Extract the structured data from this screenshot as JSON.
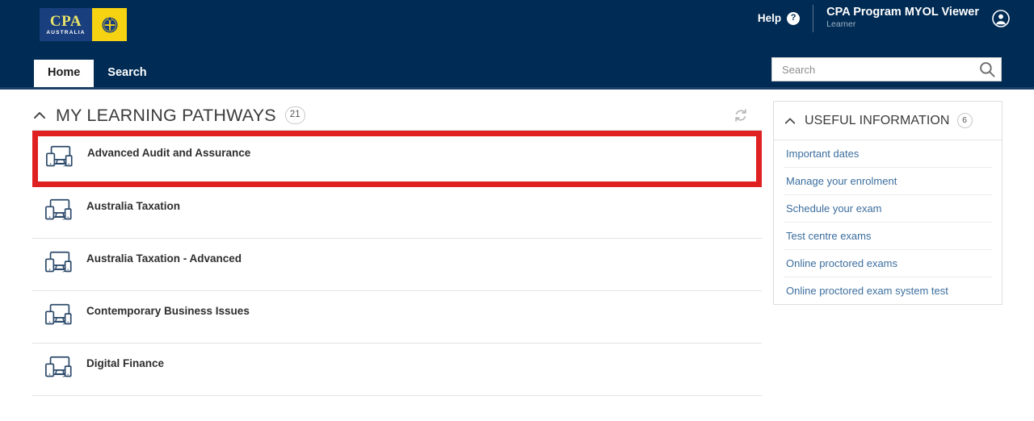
{
  "header": {
    "logo": {
      "brand": "CPA",
      "country": "AUSTRALIA",
      "crest_icon": "coat-of-arms-icon"
    },
    "help_label": "Help",
    "help_icon": "question-mark-circle-icon",
    "app_title": "CPA Program MYOL Viewer",
    "app_role": "Learner",
    "avatar_icon": "user-account-icon",
    "tabs": [
      {
        "label": "Home",
        "active": true
      },
      {
        "label": "Search",
        "active": false
      }
    ],
    "search": {
      "placeholder": "Search",
      "value": "",
      "icon": "search-icon"
    }
  },
  "main": {
    "section_title": "MY LEARNING PATHWAYS",
    "section_count": "21",
    "collapse_icon": "chevron-up-icon",
    "refresh_icon": "refresh-icon",
    "item_icon": "responsive-devices-icon",
    "pathways": [
      {
        "label": "Advanced Audit and Assurance",
        "highlighted": true
      },
      {
        "label": "Australia Taxation",
        "highlighted": false
      },
      {
        "label": "Australia Taxation - Advanced",
        "highlighted": false
      },
      {
        "label": "Contemporary Business Issues",
        "highlighted": false
      },
      {
        "label": "Digital Finance",
        "highlighted": false
      }
    ]
  },
  "sidebar": {
    "title": "USEFUL INFORMATION",
    "count": "6",
    "collapse_icon": "chevron-up-icon",
    "links": [
      {
        "label": "Important dates"
      },
      {
        "label": "Manage your enrolment"
      },
      {
        "label": "Schedule your exam"
      },
      {
        "label": "Test centre exams"
      },
      {
        "label": "Online proctored exams"
      },
      {
        "label": "Online proctored exam system test"
      }
    ]
  },
  "colors": {
    "header_navy": "#002B54",
    "logo_blue": "#1a3f7e",
    "logo_yellow": "#f5d312",
    "logo_text_yellow": "#e9e46a",
    "highlight_red": "#e02121",
    "link_blue": "#3b6e9e",
    "icon_navy": "#2d4a6b"
  }
}
